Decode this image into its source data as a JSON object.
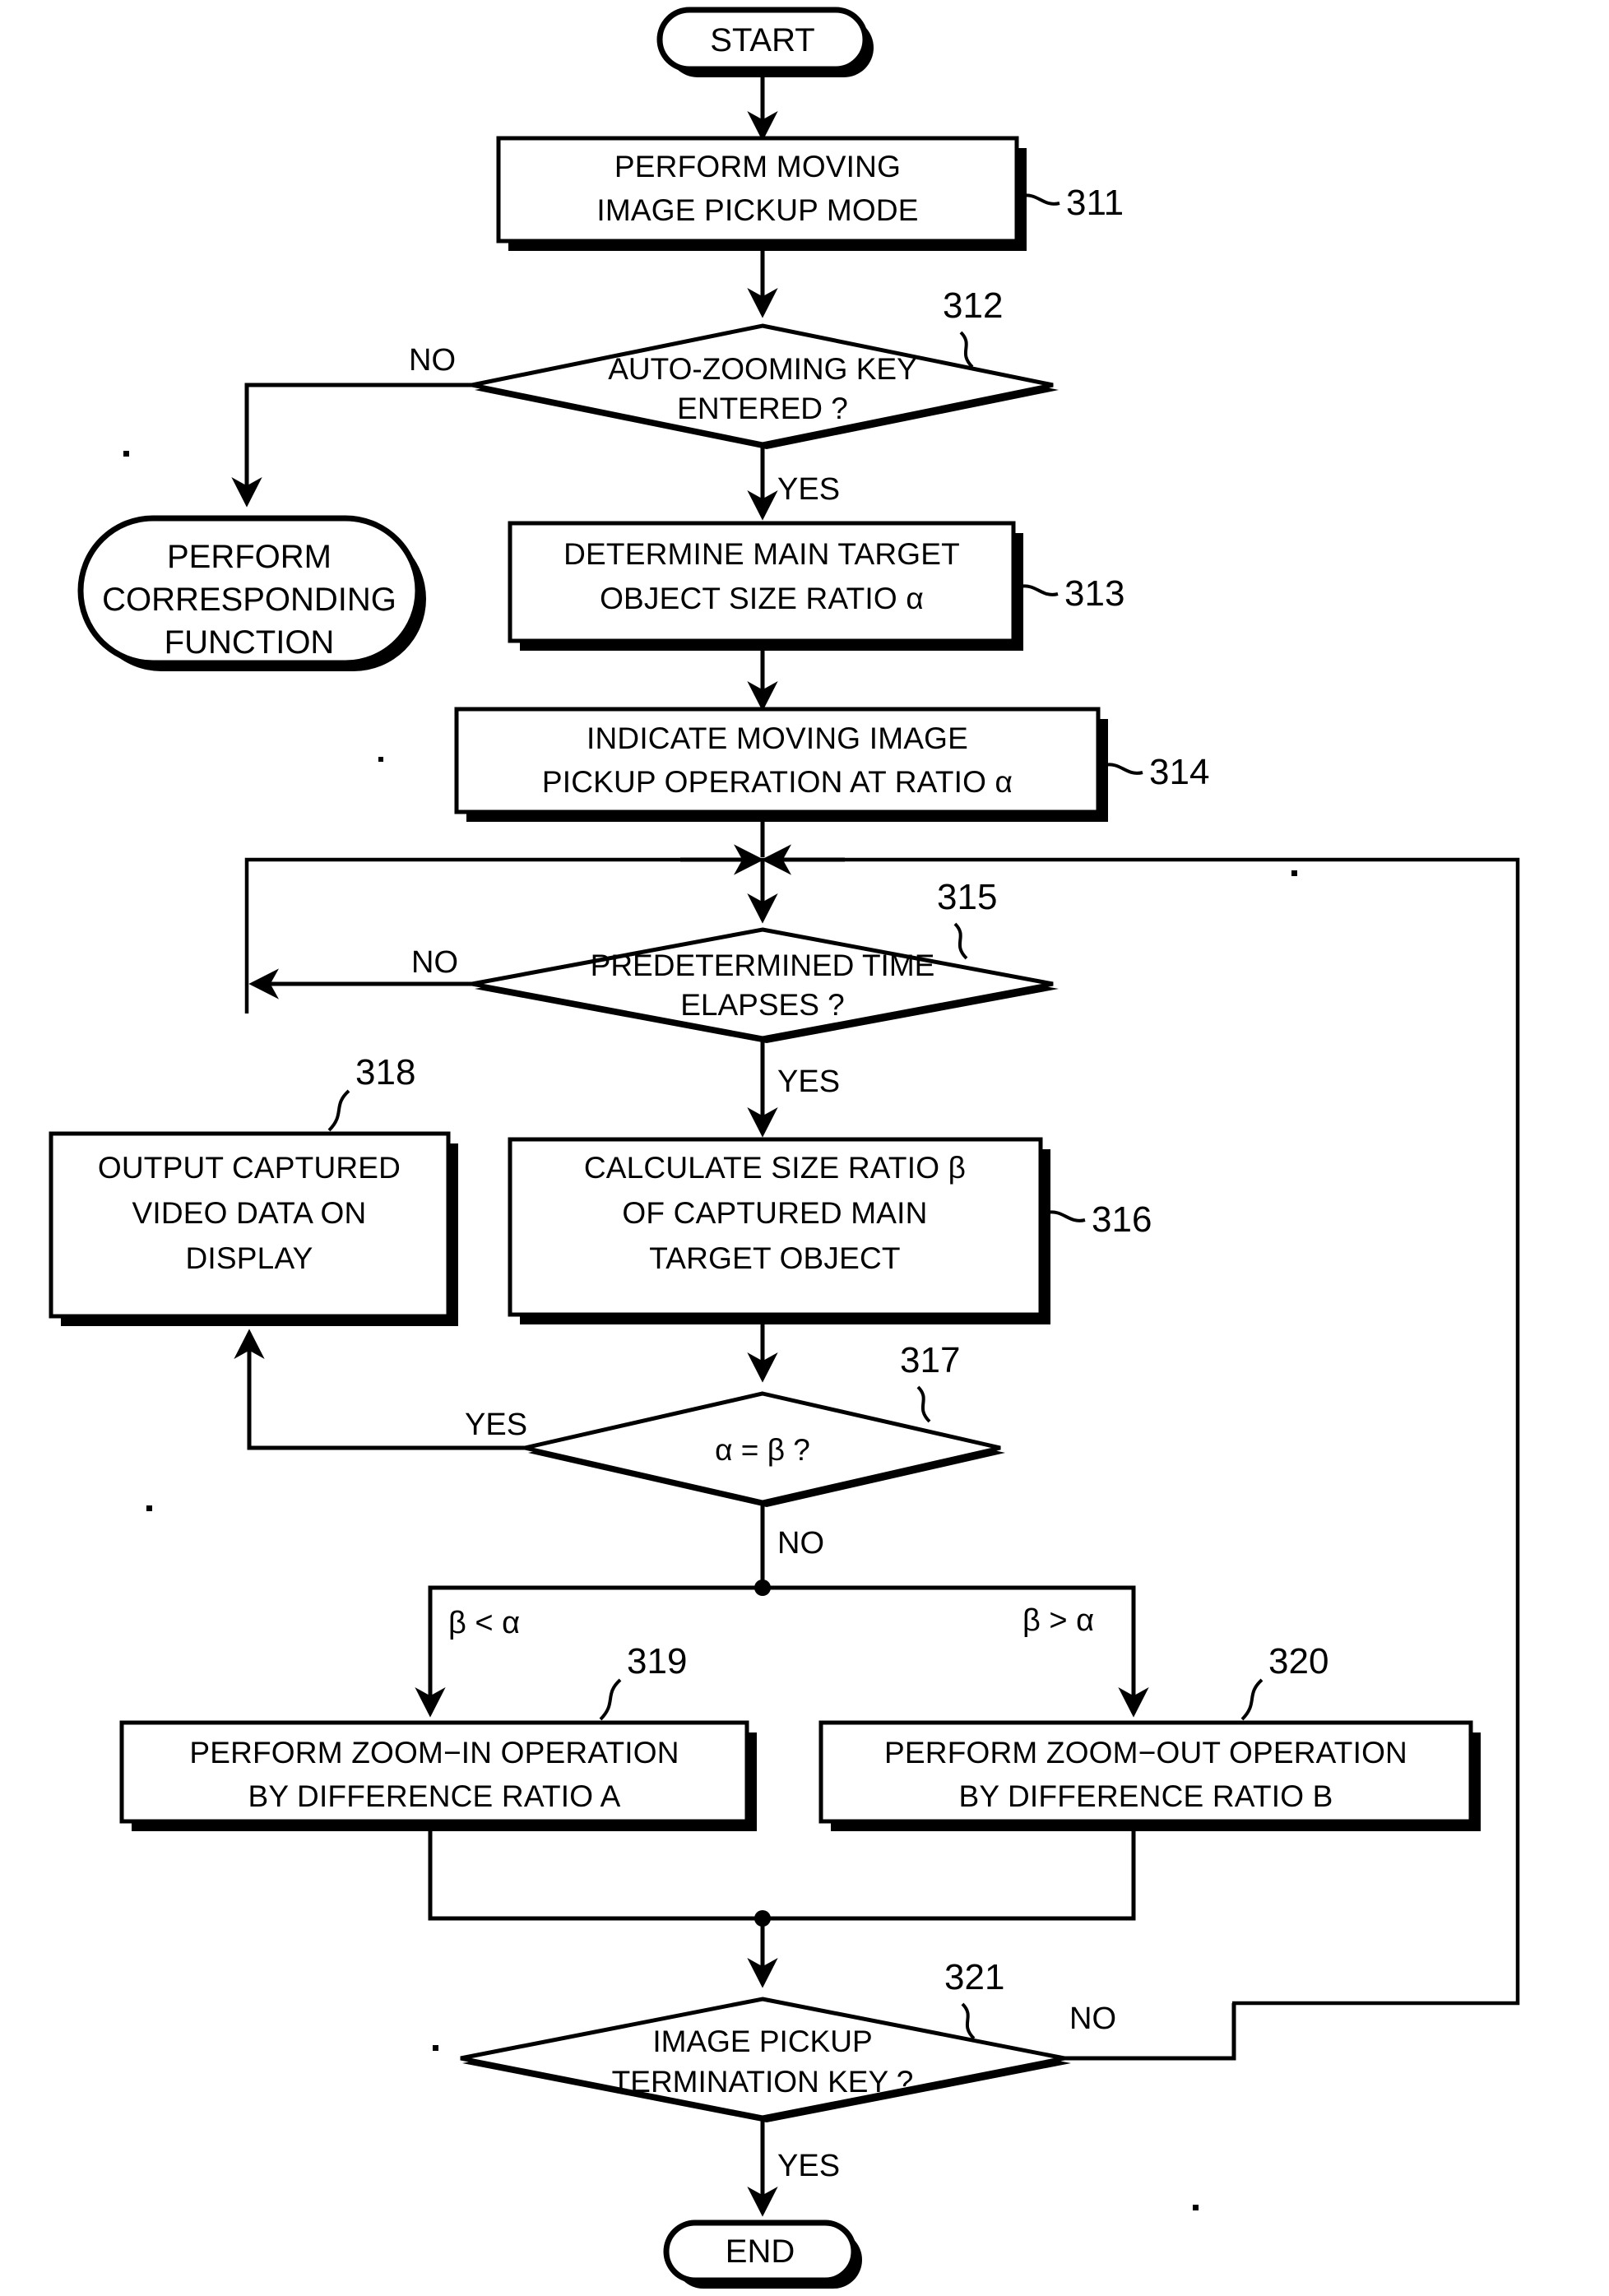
{
  "diagram": {
    "title": "Auto-zooming moving image pickup flowchart",
    "nodes": {
      "start": {
        "label": "START",
        "type": "terminator"
      },
      "n311": {
        "line1": "PERFORM MOVING",
        "line2": "IMAGE PICKUP MODE",
        "ref": "311",
        "type": "process"
      },
      "n312": {
        "line1": "AUTO-ZOOMING KEY",
        "line2": "ENTERED ?",
        "ref": "312",
        "type": "decision"
      },
      "corresp": {
        "line1": "PERFORM",
        "line2": "CORRESPONDING",
        "line3": "FUNCTION",
        "type": "terminator"
      },
      "n313": {
        "line1": "DETERMINE MAIN TARGET",
        "line2": "OBJECT SIZE RATIO α",
        "ref": "313",
        "type": "process"
      },
      "n314": {
        "line1": "INDICATE MOVING IMAGE",
        "line2": "PICKUP OPERATION AT RATIO α",
        "ref": "314",
        "type": "process"
      },
      "n315": {
        "line1": "PREDETERMINED TIME",
        "line2": "ELAPSES ?",
        "ref": "315",
        "type": "decision"
      },
      "n318": {
        "line1": "OUTPUT CAPTURED",
        "line2": "VIDEO DATA ON",
        "line3": "DISPLAY",
        "ref": "318",
        "type": "process"
      },
      "n316": {
        "line1": "CALCULATE SIZE RATIO  β",
        "line2": "OF CAPTURED MAIN",
        "line3": "TARGET OBJECT",
        "ref": "316",
        "type": "process"
      },
      "n317": {
        "line1": "α = β ?",
        "ref": "317",
        "type": "decision"
      },
      "n319": {
        "line1": "PERFORM ZOOM−IN OPERATION",
        "line2": "BY DIFFERENCE RATIO A",
        "ref": "319",
        "type": "process"
      },
      "n320": {
        "line1": "PERFORM ZOOM−OUT OPERATION",
        "line2": "BY DIFFERENCE RATIO B",
        "ref": "320",
        "type": "process"
      },
      "n321": {
        "line1": "IMAGE PICKUP",
        "line2": "TERMINATION KEY ?",
        "ref": "321",
        "type": "decision"
      },
      "end": {
        "label": "END",
        "type": "terminator"
      }
    },
    "edge_labels": {
      "e312_no": "NO",
      "e312_yes": "YES",
      "e315_no": "NO",
      "e315_yes": "YES",
      "e317_yes": "YES",
      "e317_no": "NO",
      "e319_cond": "β < α",
      "e320_cond": "β > α",
      "e321_no": "NO",
      "e321_yes": "YES"
    },
    "colors": {
      "ink": "#000000",
      "paper": "#ffffff"
    }
  }
}
